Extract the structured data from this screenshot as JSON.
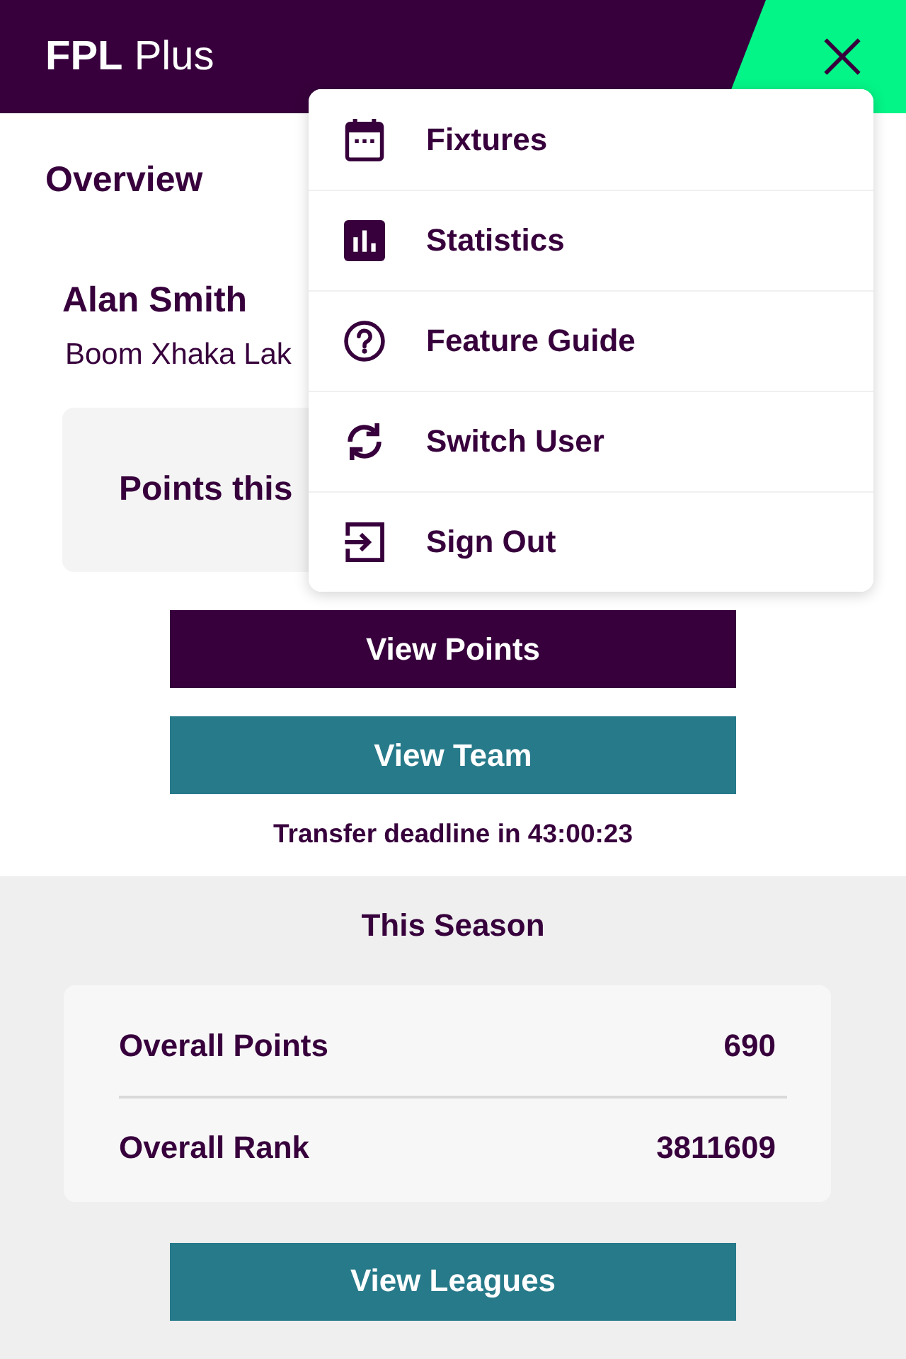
{
  "header": {
    "title": "**FPL** Plus"
  },
  "overview": {
    "heading": "Overview",
    "manager_name": "Alan Smith",
    "team_name": "Boom Xhaka Lak",
    "points_card": {
      "label": "Points this"
    },
    "buttons": [
      {
        "label": "View Points",
        "kind": "primary"
      },
      {
        "label": "View Team",
        "kind": "secondary"
      }
    ],
    "deadline": "Transfer deadline in 43:00:23"
  },
  "season": {
    "heading": "This Season",
    "stats": [
      {
        "label": "Overall Points",
        "value": "690"
      },
      {
        "label": "Overall Rank",
        "value": "3811609"
      }
    ],
    "button": {
      "label": "View Leagues",
      "kind": "secondary"
    }
  },
  "menu": {
    "open": true,
    "items": [
      {
        "label": "Fixtures"
      },
      {
        "label": "Statistics"
      },
      {
        "label": "Feature Guide"
      },
      {
        "label": "Switch User"
      },
      {
        "label": "Sign Out"
      }
    ]
  }
}
